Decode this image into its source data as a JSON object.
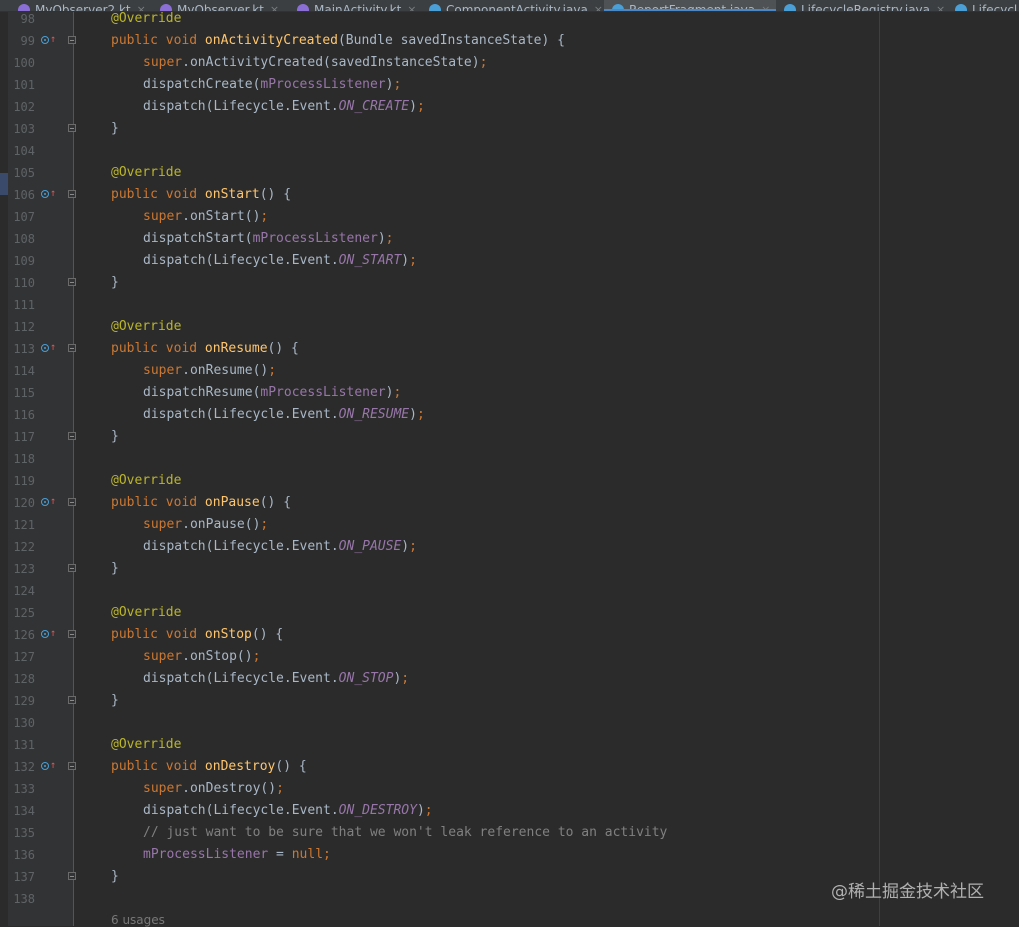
{
  "tabs": [
    {
      "label": "MyObserver2.kt",
      "icon": "kotlin-file-icon",
      "color": "#8c6fd6",
      "active": false
    },
    {
      "label": "MyObserver.kt",
      "icon": "kotlin-file-icon",
      "color": "#8c6fd6",
      "active": false
    },
    {
      "label": "MainActivity.kt",
      "icon": "kotlin-file-icon",
      "color": "#8c6fd6",
      "active": false
    },
    {
      "label": "ComponentActivity.java",
      "icon": "java-class-icon",
      "color": "#4a9fd6",
      "active": false
    },
    {
      "label": "ReportFragment.java",
      "icon": "java-class-icon",
      "color": "#4a9fd6",
      "active": true
    },
    {
      "label": "LifecycleRegistry.java",
      "icon": "java-class-icon",
      "color": "#4a9fd6",
      "active": false
    },
    {
      "label": "Lifecycl",
      "icon": "java-class-icon",
      "color": "#4a9fd6",
      "active": false
    }
  ],
  "editor": {
    "lines": [
      {
        "n": "98",
        "text": "@Override"
      },
      {
        "n": "99",
        "text": "public void onActivityCreated(Bundle savedInstanceState) {"
      },
      {
        "n": "100",
        "text": "super.onActivityCreated(savedInstanceState);"
      },
      {
        "n": "101",
        "text": "dispatchCreate(mProcessListener);"
      },
      {
        "n": "102",
        "text": "dispatch(Lifecycle.Event.ON_CREATE);"
      },
      {
        "n": "103",
        "text": "}"
      },
      {
        "n": "104",
        "text": ""
      },
      {
        "n": "105",
        "text": "@Override"
      },
      {
        "n": "106",
        "text": "public void onStart() {"
      },
      {
        "n": "107",
        "text": "super.onStart();"
      },
      {
        "n": "108",
        "text": "dispatchStart(mProcessListener);"
      },
      {
        "n": "109",
        "text": "dispatch(Lifecycle.Event.ON_START);"
      },
      {
        "n": "110",
        "text": "}"
      },
      {
        "n": "111",
        "text": ""
      },
      {
        "n": "112",
        "text": "@Override"
      },
      {
        "n": "113",
        "text": "public void onResume() {"
      },
      {
        "n": "114",
        "text": "super.onResume();"
      },
      {
        "n": "115",
        "text": "dispatchResume(mProcessListener);"
      },
      {
        "n": "116",
        "text": "dispatch(Lifecycle.Event.ON_RESUME);"
      },
      {
        "n": "117",
        "text": "}"
      },
      {
        "n": "118",
        "text": ""
      },
      {
        "n": "119",
        "text": "@Override"
      },
      {
        "n": "120",
        "text": "public void onPause() {"
      },
      {
        "n": "121",
        "text": "super.onPause();"
      },
      {
        "n": "122",
        "text": "dispatch(Lifecycle.Event.ON_PAUSE);"
      },
      {
        "n": "123",
        "text": "}"
      },
      {
        "n": "124",
        "text": ""
      },
      {
        "n": "125",
        "text": "@Override"
      },
      {
        "n": "126",
        "text": "public void onStop() {"
      },
      {
        "n": "127",
        "text": "super.onStop();"
      },
      {
        "n": "128",
        "text": "dispatch(Lifecycle.Event.ON_STOP);"
      },
      {
        "n": "129",
        "text": "}"
      },
      {
        "n": "130",
        "text": ""
      },
      {
        "n": "131",
        "text": "@Override"
      },
      {
        "n": "132",
        "text": "public void onDestroy() {"
      },
      {
        "n": "133",
        "text": "super.onDestroy();"
      },
      {
        "n": "134",
        "text": "dispatch(Lifecycle.Event.ON_DESTROY);"
      },
      {
        "n": "135",
        "text": "// just want to be sure that we won't leak reference to an activity"
      },
      {
        "n": "136",
        "text": "mProcessListener = null;"
      },
      {
        "n": "137",
        "text": "}"
      },
      {
        "n": "138",
        "text": ""
      }
    ],
    "usages_hint": "6 usages"
  },
  "watermark": "@稀土掘金技术社区",
  "colors": {
    "background": "#2b2b2b",
    "gutter": "#313335",
    "annotation": "#bbb529",
    "keyword": "#cc7832",
    "method": "#ffc66d",
    "field": "#9876aa",
    "comment": "#808080",
    "text": "#a9b7c6",
    "active_tab_underline": "#4a88c7"
  }
}
